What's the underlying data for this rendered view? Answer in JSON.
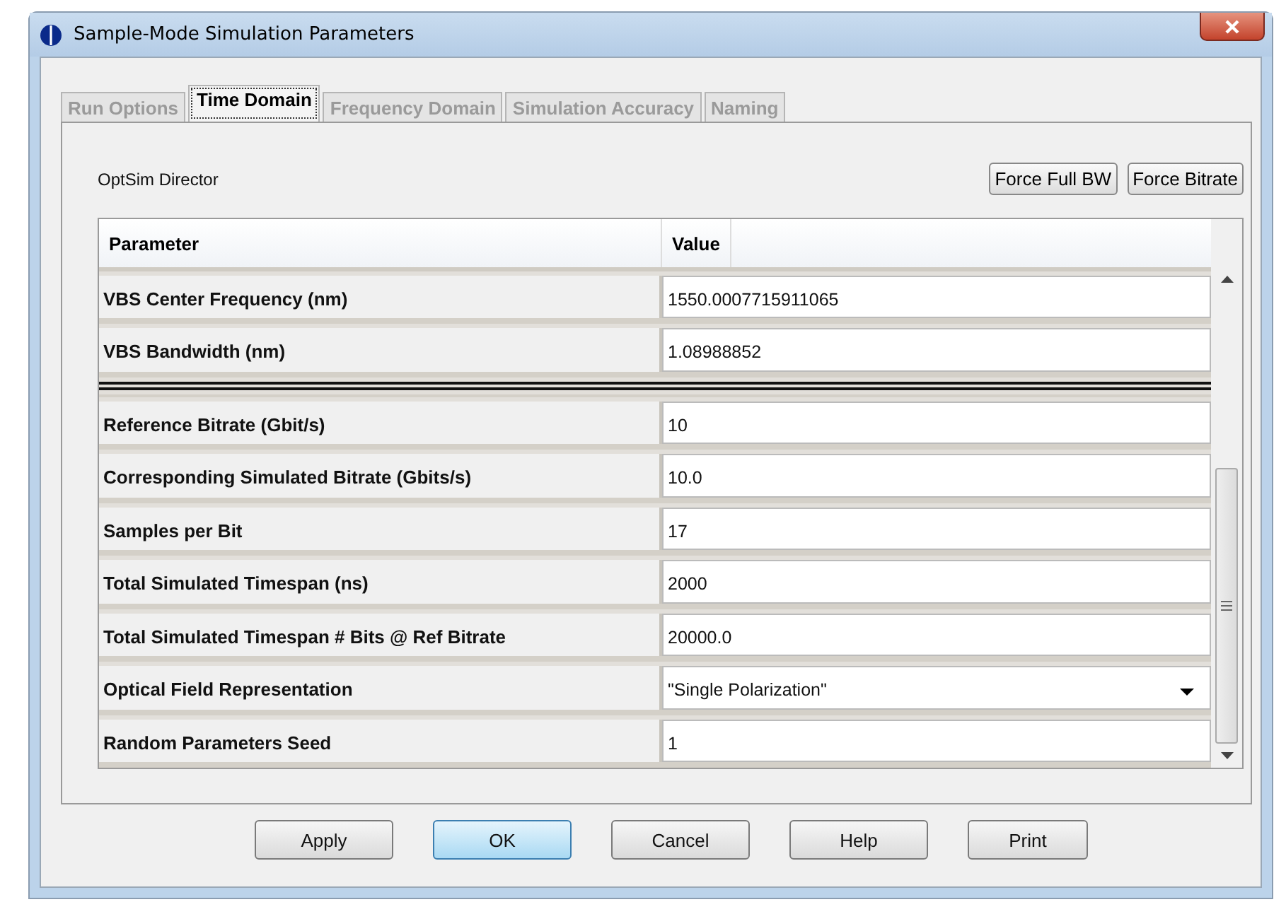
{
  "window": {
    "title": "Sample-Mode Simulation Parameters"
  },
  "tabs": [
    {
      "label": "Run Options",
      "selected": false
    },
    {
      "label": "Time Domain",
      "selected": true
    },
    {
      "label": "Frequency Domain",
      "selected": false
    },
    {
      "label": "Simulation Accuracy",
      "selected": false
    },
    {
      "label": "Naming",
      "selected": false
    }
  ],
  "director_label": "OptSim Director",
  "toolbar_buttons": [
    "Force Full BW",
    "Force Bitrate"
  ],
  "table": {
    "columns": [
      "Parameter",
      "Value"
    ],
    "rows": [
      {
        "kind": "text",
        "parameter": "VBS Center Frequency (nm)",
        "value": "1550.0007715911065"
      },
      {
        "kind": "text",
        "parameter": "VBS Bandwidth (nm)",
        "value": "1.08988852"
      },
      {
        "kind": "separator"
      },
      {
        "kind": "text",
        "parameter": "Reference Bitrate (Gbit/s)",
        "value": "10"
      },
      {
        "kind": "text",
        "parameter": "Corresponding Simulated Bitrate (Gbits/s)",
        "value": "10.0"
      },
      {
        "kind": "text",
        "parameter": "Samples per Bit",
        "value": "17"
      },
      {
        "kind": "text",
        "parameter": "Total Simulated Timespan (ns)",
        "value": "2000"
      },
      {
        "kind": "text",
        "parameter": "Total Simulated Timespan # Bits @ Ref Bitrate",
        "value": "20000.0"
      },
      {
        "kind": "dropdown",
        "parameter": "Optical Field Representation",
        "value": "\"Single Polarization\""
      },
      {
        "kind": "text",
        "parameter": "Random Parameters Seed",
        "value": "1"
      }
    ]
  },
  "buttons": [
    {
      "label": "Apply",
      "default": false
    },
    {
      "label": "OK",
      "default": true
    },
    {
      "label": "Cancel",
      "default": false
    },
    {
      "label": "Help",
      "default": false
    },
    {
      "label": "Print",
      "default": false
    }
  ]
}
